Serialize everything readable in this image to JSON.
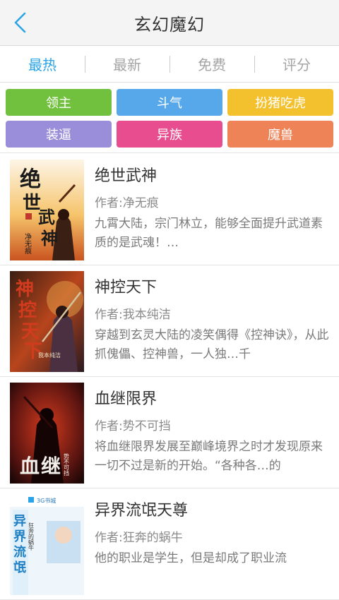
{
  "header": {
    "title": "玄幻魔幻"
  },
  "tabs": [
    {
      "label": "最热",
      "active": true
    },
    {
      "label": "最新",
      "active": false
    },
    {
      "label": "免费",
      "active": false
    },
    {
      "label": "评分",
      "active": false
    }
  ],
  "tags": [
    {
      "label": "领主",
      "color": "#72c13e"
    },
    {
      "label": "斗气",
      "color": "#57a8ea"
    },
    {
      "label": "扮猪吃虎",
      "color": "#f4c12e"
    },
    {
      "label": "装逼",
      "color": "#9a8dd9"
    },
    {
      "label": "异族",
      "color": "#e84d8f"
    },
    {
      "label": "魔兽",
      "color": "#ee8358"
    }
  ],
  "books": [
    {
      "title": "绝世武神",
      "author": "作者:净无痕",
      "desc": "九霄大陆，宗门林立，能够全面提升武道素质的是武魂！…",
      "cover_text": [
        "绝",
        "世",
        "武",
        "神"
      ],
      "cover_author": "净无痕"
    },
    {
      "title": "神控天下",
      "author": "作者:我本纯洁",
      "desc": "穿越到玄灵大陆的凌笑偶得《控神诀》，从此抓傀儡、控神兽，一人独…千",
      "cover_text": [
        "神",
        "控",
        "天",
        "下"
      ],
      "cover_author": "我本纯洁"
    },
    {
      "title": "血继限界",
      "author": "作者:势不可挡",
      "desc": "将血继限界发展至巅峰境界之时才发现原来一切不过是新的开始。“各种各…的",
      "cover_text": [
        "血",
        "继"
      ],
      "cover_author": "势不可挡"
    },
    {
      "title": "异界流氓天尊",
      "author": "作者:狂奔的蜗牛",
      "desc": "他的职业是学生，但是却成了职业流",
      "cover_text": [
        "异",
        "界",
        "流",
        "氓"
      ],
      "cover_author": "狂奔的蜗牛",
      "cover_badge": "3G书城"
    }
  ]
}
